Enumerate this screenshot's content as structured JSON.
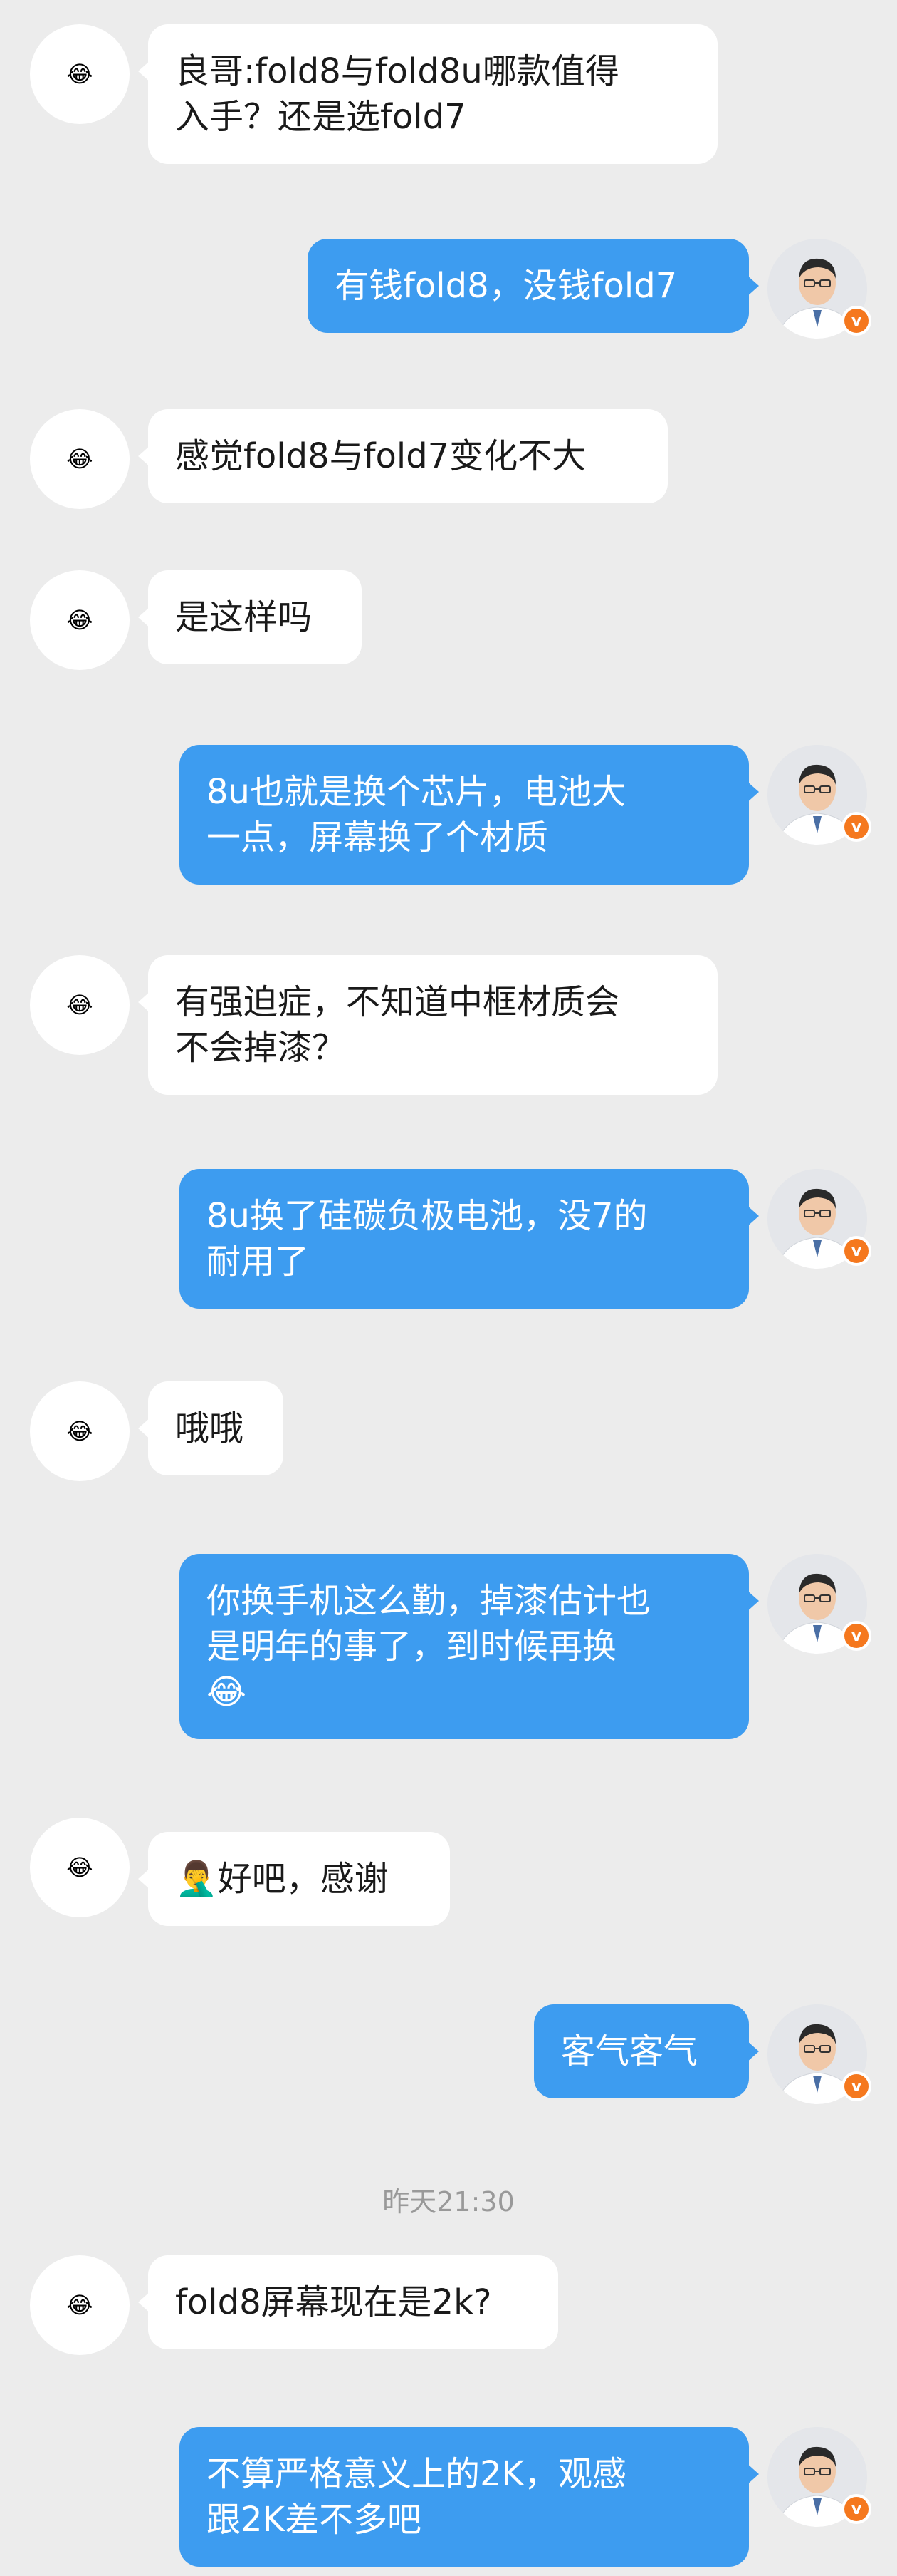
{
  "contacts": {
    "other_avatar_emoji": "😂",
    "self_badge": "v"
  },
  "colors": {
    "background": "#ececec",
    "incoming_bubble": "#ffffff",
    "outgoing_bubble": "#3d9cf0",
    "badge": "#f5781e"
  },
  "messages": [
    {
      "side": "left",
      "lines": [
        "良哥:fold8与fold8u哪款值得",
        "入手？还是选fold7"
      ]
    },
    {
      "side": "right",
      "lines": [
        "有钱fold8，没钱fold7"
      ]
    },
    {
      "side": "left",
      "lines": [
        "感觉fold8与fold7变化不大"
      ]
    },
    {
      "side": "left",
      "lines": [
        "是这样吗"
      ]
    },
    {
      "side": "right",
      "lines": [
        "8u也就是换个芯片，电池大",
        "一点，屏幕换了个材质"
      ]
    },
    {
      "side": "left",
      "lines": [
        "有强迫症，不知道中框材质会",
        "不会掉漆？"
      ]
    },
    {
      "side": "right",
      "lines": [
        "8u换了硅碳负极电池，没7的",
        "耐用了"
      ]
    },
    {
      "side": "left",
      "lines": [
        "哦哦"
      ]
    },
    {
      "side": "right",
      "lines": [
        "你换手机这么勤，掉漆估计也",
        "是明年的事了，到时候再换",
        "😂"
      ]
    },
    {
      "side": "left",
      "lines": [
        "🤦‍♂️好吧，感谢"
      ]
    },
    {
      "side": "right",
      "lines": [
        "客气客气"
      ]
    },
    {
      "side": "left",
      "lines": [
        "fold8屏幕现在是2k?"
      ]
    },
    {
      "side": "right",
      "lines": [
        "不算严格意义上的2K，观感",
        "跟2K差不多吧"
      ]
    }
  ],
  "timestamp": "昨天21:30"
}
